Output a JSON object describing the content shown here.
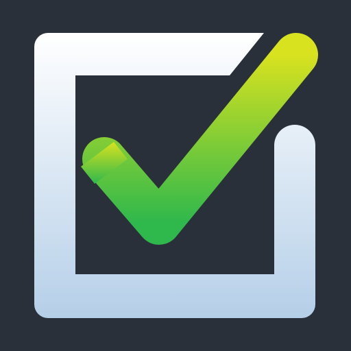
{
  "icon": {
    "name": "checkbox-checked-icon",
    "colors": {
      "background": "#2a3039",
      "box_top": "#ffffff",
      "box_bottom": "#b5cfe8",
      "check_top": "#d8e21f",
      "check_bottom": "#2fb84c"
    }
  }
}
